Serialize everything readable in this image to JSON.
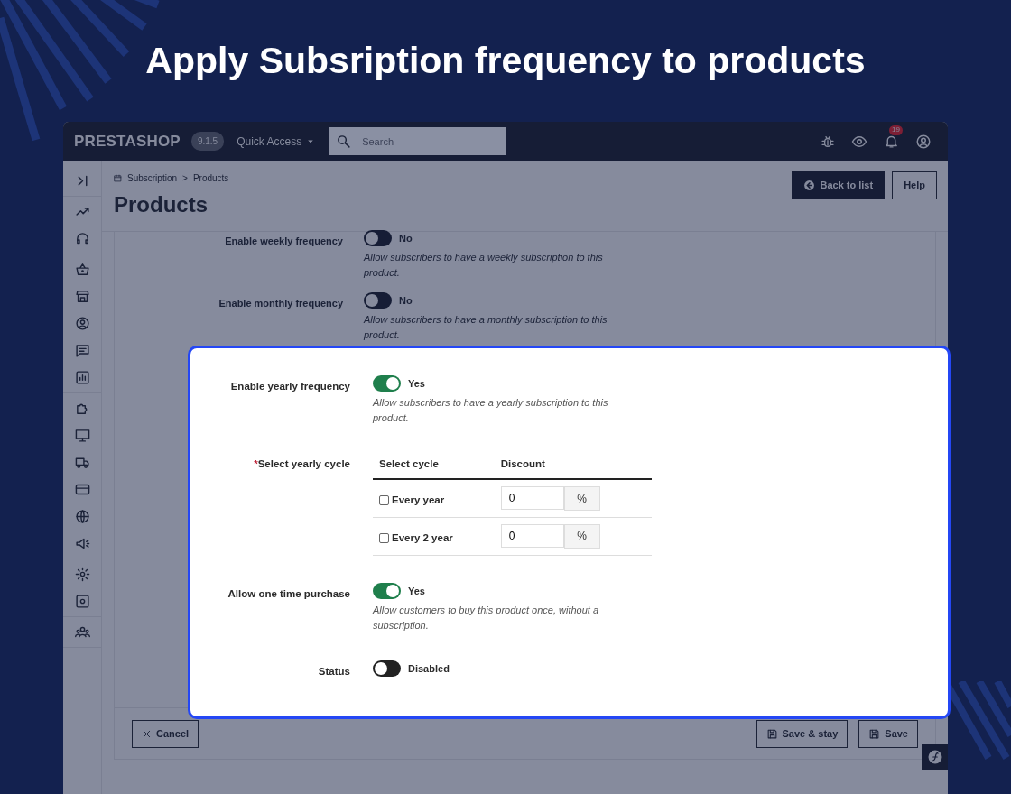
{
  "headline": "Apply Subsription frequency to products",
  "topbar": {
    "logo": "PRESTASHOP",
    "version": "9.1.5",
    "quick_access": "Quick Access",
    "search": {
      "placeholder": "Search"
    },
    "notification_count": "19"
  },
  "breadcrumb": [
    "Subscription",
    ">",
    "Products"
  ],
  "page_title": "Products",
  "header_buttons": [
    {
      "label": "Back to list",
      "kind": "primary"
    },
    {
      "label": "Help",
      "kind": "outline"
    }
  ],
  "background_fields": [
    {
      "label": "Enable weekly frequency",
      "on": false,
      "state_text": "No",
      "help": "Allow subscribers to have a weekly subscription to this product."
    },
    {
      "label": "Enable monthly frequency",
      "on": false,
      "state_text": "No",
      "help": "Allow subscribers to have a monthly subscription to this product."
    }
  ],
  "highlight_fields": [
    {
      "kind": "toggle",
      "label": "Enable yearly frequency",
      "on": true,
      "state_text": "Yes",
      "help": "Allow subscribers to have a yearly subscription to this product."
    },
    {
      "kind": "cycle_table",
      "label": "Select yearly cycle",
      "required_mark": "*",
      "columns": [
        "Select cycle",
        "Discount"
      ],
      "rows": [
        {
          "label": "Every year",
          "checked": false,
          "value": "0",
          "unit": "%"
        },
        {
          "label": "Every 2 year",
          "checked": false,
          "value": "0",
          "unit": "%"
        }
      ]
    },
    {
      "kind": "toggle",
      "label": "Allow one time purchase",
      "on": true,
      "state_text": "Yes",
      "help": "Allow customers to buy this product once, without a subscription."
    },
    {
      "kind": "toggle",
      "label": "Status",
      "on": false,
      "state_text": "Disabled"
    }
  ],
  "footer_buttons": {
    "left": [
      {
        "label": "Cancel",
        "kind": "cancel"
      }
    ],
    "right": [
      {
        "label": "Save & stay",
        "kind": "save"
      },
      {
        "label": "Save",
        "kind": "save"
      }
    ]
  }
}
